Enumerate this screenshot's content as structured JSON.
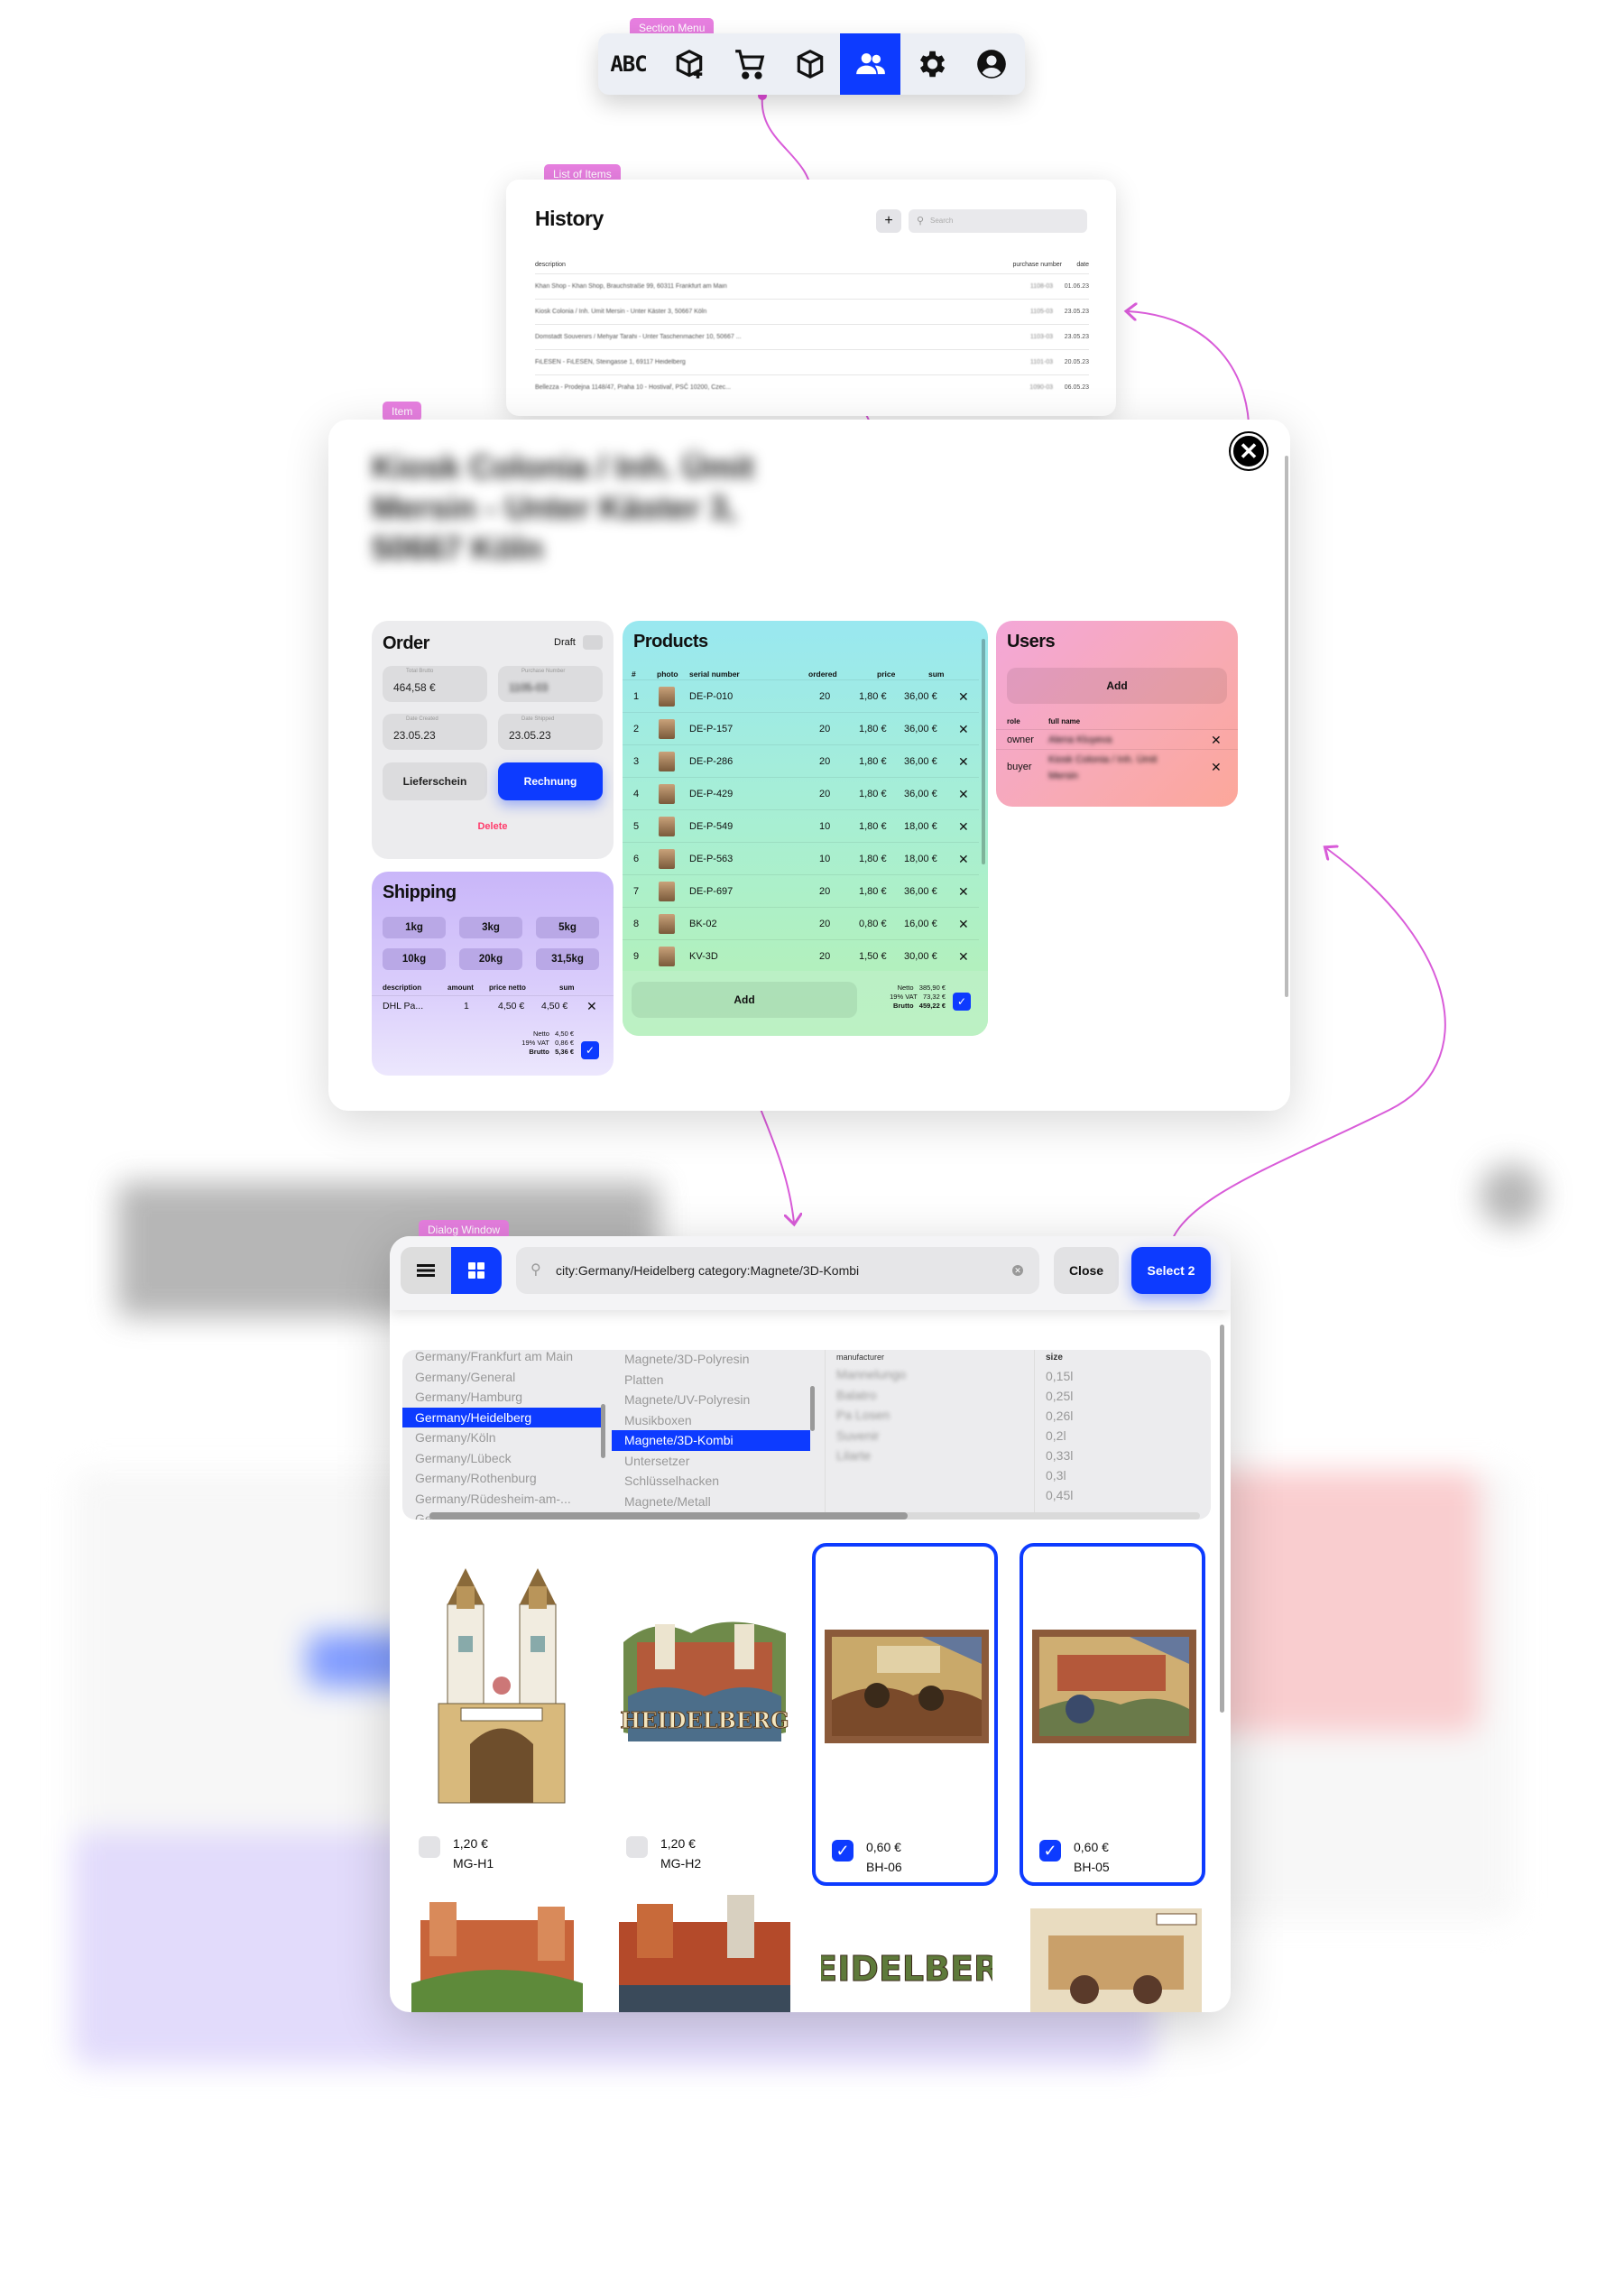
{
  "tags": {
    "section_menu": "Section Menu",
    "list_of_items": "List of Items",
    "item": "Item",
    "dialog_window": "Dialog Window"
  },
  "toolbar": {
    "abc_label": "ABC",
    "active_item": "users",
    "accent_color": "#0d3bff",
    "icons": [
      "abc-icon",
      "box-add-icon",
      "cart-icon",
      "package-icon",
      "users-icon",
      "gear-icon",
      "account-icon"
    ]
  },
  "history": {
    "title": "History",
    "add_label": "+",
    "search_placeholder": "Search",
    "columns": {
      "description": "description",
      "purchase_number": "purchase number",
      "date": "date"
    },
    "rows": [
      {
        "description": "Khan Shop - Khan Shop, Brauchstraße 99, 60311 Frankfurt am Main",
        "purchase_number": "1108-03",
        "date": "01.06.23"
      },
      {
        "description": "Kiosk Colonia / Inh. Ümit Mersin - Unter Käster 3, 50667 Köln",
        "purchase_number": "1105-03",
        "date": "23.05.23"
      },
      {
        "description": "Domstadt Souvenirs / Mehyar Tarahi - Unter Taschenmacher 10, 50667 ...",
        "purchase_number": "1103-03",
        "date": "23.05.23"
      },
      {
        "description": "FiLESEN - FiLESEN, Steingasse 1, 69117 Heidelberg",
        "purchase_number": "1101-03",
        "date": "20.05.23"
      },
      {
        "description": "Bellezza - Prodejna 1148/47, Praha 10 - Hostivař, PSČ 10200, Czec...",
        "purchase_number": "1090-03",
        "date": "06.05.23"
      }
    ]
  },
  "item": {
    "title": "Kiosk Colonia / Inh. Ümit Mersin - Unter Käster 3, 50667 Köln",
    "order": {
      "title": "Order",
      "draft_label": "Draft",
      "total_brutto_label": "Total Brutto",
      "total_brutto": "464,58 €",
      "purchase_number_label": "Purchase Number",
      "purchase_number": "1105-03",
      "date_created_label": "Date Created",
      "date_created": "23.05.23",
      "date_shipped_label": "Date Shipped",
      "date_shipped": "23.05.23",
      "lieferschein_label": "Lieferschein",
      "rechnung_label": "Rechnung",
      "delete_label": "Delete"
    },
    "shipping": {
      "title": "Shipping",
      "weights": [
        "1kg",
        "3kg",
        "5kg",
        "10kg",
        "20kg",
        "31,5kg"
      ],
      "columns": {
        "description": "description",
        "amount": "amount",
        "price_netto": "price netto",
        "sum": "sum"
      },
      "row": {
        "description": "DHL Pa...",
        "amount": "1",
        "price_netto": "4,50 €",
        "sum": "4,50 €"
      },
      "totals": {
        "netto_label": "Netto",
        "netto": "4,50 €",
        "vat_label": "19% VAT",
        "vat": "0,86 €",
        "brutto_label": "Brutto",
        "brutto": "5,36 €"
      }
    },
    "products": {
      "title": "Products",
      "columns": {
        "num": "#",
        "photo": "photo",
        "serial": "serial number",
        "ordered": "ordered",
        "price": "price",
        "sum": "sum"
      },
      "rows": [
        {
          "num": "1",
          "serial": "DE-P-010",
          "ordered": "20",
          "price": "1,80 €",
          "sum": "36,00 €"
        },
        {
          "num": "2",
          "serial": "DE-P-157",
          "ordered": "20",
          "price": "1,80 €",
          "sum": "36,00 €"
        },
        {
          "num": "3",
          "serial": "DE-P-286",
          "ordered": "20",
          "price": "1,80 €",
          "sum": "36,00 €"
        },
        {
          "num": "4",
          "serial": "DE-P-429",
          "ordered": "20",
          "price": "1,80 €",
          "sum": "36,00 €"
        },
        {
          "num": "5",
          "serial": "DE-P-549",
          "ordered": "10",
          "price": "1,80 €",
          "sum": "18,00 €"
        },
        {
          "num": "6",
          "serial": "DE-P-563",
          "ordered": "10",
          "price": "1,80 €",
          "sum": "18,00 €"
        },
        {
          "num": "7",
          "serial": "DE-P-697",
          "ordered": "20",
          "price": "1,80 €",
          "sum": "36,00 €"
        },
        {
          "num": "8",
          "serial": "BK-02",
          "ordered": "20",
          "price": "0,80 €",
          "sum": "16,00 €"
        },
        {
          "num": "9",
          "serial": "KV-3D",
          "ordered": "20",
          "price": "1,50 €",
          "sum": "30,00 €"
        }
      ],
      "add_label": "Add",
      "totals": {
        "netto_label": "Netto",
        "netto": "385,90 €",
        "vat_label": "19% VAT",
        "vat": "73,32 €",
        "brutto_label": "Brutto",
        "brutto": "459,22 €"
      }
    },
    "users": {
      "title": "Users",
      "add_label": "Add",
      "columns": {
        "role": "role",
        "full_name": "full name"
      },
      "rows": [
        {
          "role": "owner",
          "full_name": "Alena Kluyeva"
        },
        {
          "role": "buyer",
          "full_name": "Kiosk Colonia / Inh. Ümit Mersin"
        }
      ]
    }
  },
  "dialog": {
    "search_value": "city:Germany/Heidelberg category:Magnete/3D-Kombi",
    "close_label": "Close",
    "select_label": "Select 2",
    "cities": [
      "Germany/Frankfurt am Main",
      "Germany/General",
      "Germany/Hamburg",
      "Germany/Heidelberg",
      "Germany/Köln",
      "Germany/Lübeck",
      "Germany/Rothenburg",
      "Germany/Rüdesheim-am-...",
      "Germany/..."
    ],
    "selected_city": "Germany/Heidelberg",
    "categories": [
      "Magnete/3D-Polyresin",
      "Platten",
      "Magnete/UV-Polyresin",
      "Musikboxen",
      "Magnete/3D-Kombi",
      "Untersetzer",
      "Schlüsselhacken",
      "Magnete/Metall"
    ],
    "selected_category": "Magnete/3D-Kombi",
    "manufacturer_label": "manufacturer",
    "manufacturers": [
      "Mannelungo",
      "Balatro",
      "Pa Losen",
      "Suvenir",
      "Lilarte"
    ],
    "size_label": "size",
    "sizes": [
      "0,15l",
      "0,25l",
      "0,26l",
      "0,2l",
      "0,33l",
      "0,3l",
      "0,45l"
    ],
    "items": [
      {
        "price": "1,20 €",
        "code": "MG-H1",
        "selected": false
      },
      {
        "price": "1,20 €",
        "code": "MG-H2",
        "selected": false
      },
      {
        "price": "0,60 €",
        "code": "BH-06",
        "selected": true
      },
      {
        "price": "0,60 €",
        "code": "BH-05",
        "selected": true
      }
    ],
    "magnet_text_heidelberg": "HEIDELBERG"
  }
}
